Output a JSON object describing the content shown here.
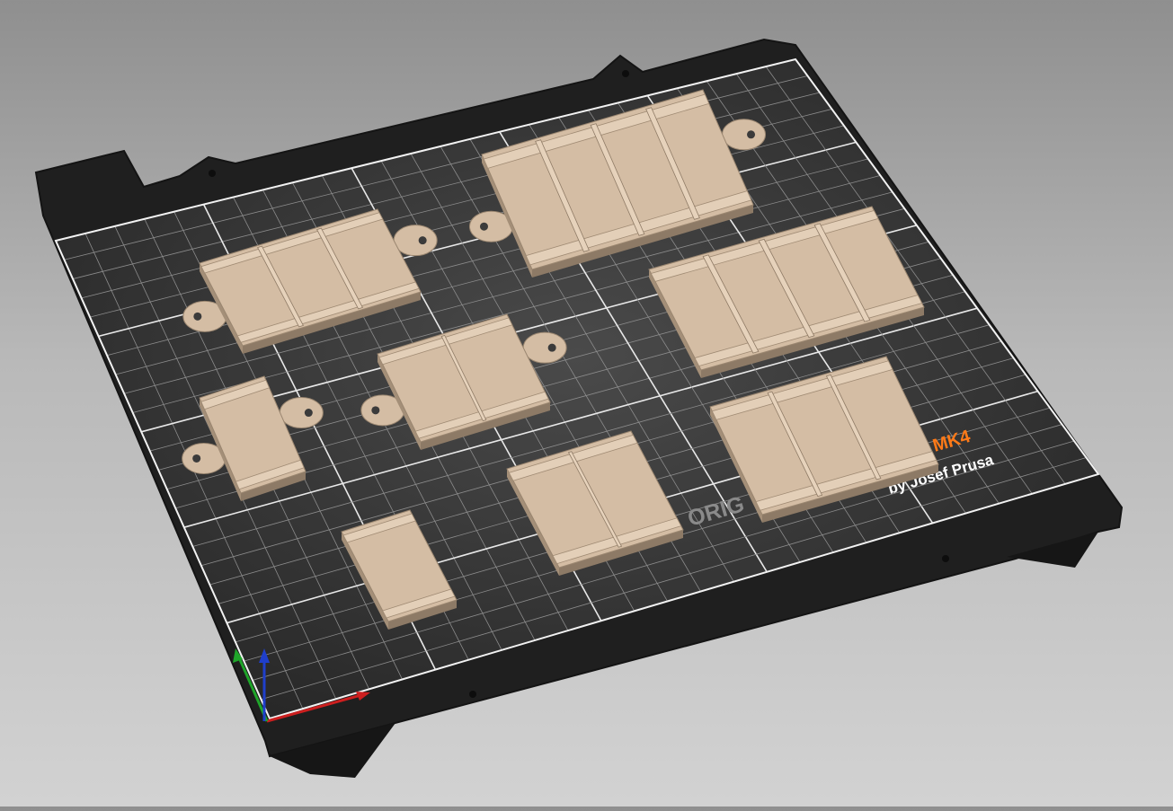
{
  "viewport": {
    "name": "3D plater view",
    "bed": {
      "brand_text": "ORIG",
      "model_text": "MK4",
      "byline_text": "by Josef Prusa",
      "surface_color": "#2a2a2a",
      "frame_color": "#1c1c1c",
      "grid_color": "#ffffff",
      "brand_accent_color": "#ff7a18"
    },
    "objects": [
      {
        "name": "strip-3-cells-with-tabs",
        "cells": 3,
        "tabs": true
      },
      {
        "name": "strip-4-cells-with-tabs",
        "cells": 4,
        "tabs": true
      },
      {
        "name": "strip-4-cells",
        "cells": 4,
        "tabs": false
      },
      {
        "name": "strip-2-cells-with-tabs",
        "cells": 2,
        "tabs": true
      },
      {
        "name": "strip-1-cell-with-tabs",
        "cells": 1,
        "tabs": true
      },
      {
        "name": "strip-3-cells",
        "cells": 3,
        "tabs": false
      },
      {
        "name": "strip-2-cells",
        "cells": 2,
        "tabs": false
      },
      {
        "name": "strip-1-cell",
        "cells": 1,
        "tabs": false
      }
    ],
    "object_color": "#d4bda4",
    "axes": {
      "x_color": "#cc1f1f",
      "y_color": "#1fa52a",
      "z_color": "#1f3fcc"
    }
  }
}
